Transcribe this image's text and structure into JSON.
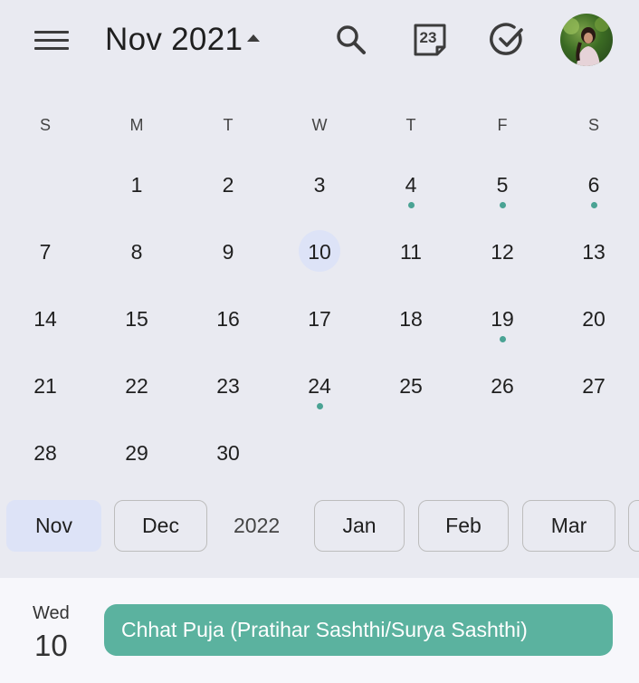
{
  "header": {
    "month_title": "Nov 2021",
    "today_icon_date": "23",
    "icons": [
      "menu-icon",
      "caret-up-icon",
      "search-icon",
      "calendar-today-icon",
      "tasks-check-icon",
      "avatar"
    ]
  },
  "weekdays": [
    "S",
    "M",
    "T",
    "W",
    "T",
    "F",
    "S"
  ],
  "calendar": {
    "selected_day": "10",
    "weeks": [
      [
        {
          "d": ""
        },
        {
          "d": "1"
        },
        {
          "d": "2"
        },
        {
          "d": "3"
        },
        {
          "d": "4",
          "event": true
        },
        {
          "d": "5",
          "event": true
        },
        {
          "d": "6",
          "event": true
        }
      ],
      [
        {
          "d": "7"
        },
        {
          "d": "8"
        },
        {
          "d": "9"
        },
        {
          "d": "10",
          "selected": true
        },
        {
          "d": "11"
        },
        {
          "d": "12"
        },
        {
          "d": "13"
        }
      ],
      [
        {
          "d": "14"
        },
        {
          "d": "15"
        },
        {
          "d": "16"
        },
        {
          "d": "17"
        },
        {
          "d": "18"
        },
        {
          "d": "19",
          "event": true
        },
        {
          "d": "20"
        }
      ],
      [
        {
          "d": "21"
        },
        {
          "d": "22"
        },
        {
          "d": "23"
        },
        {
          "d": "24",
          "event": true
        },
        {
          "d": "25"
        },
        {
          "d": "26"
        },
        {
          "d": "27"
        }
      ],
      [
        {
          "d": "28"
        },
        {
          "d": "29"
        },
        {
          "d": "30"
        },
        {
          "d": ""
        },
        {
          "d": ""
        },
        {
          "d": ""
        },
        {
          "d": ""
        }
      ]
    ]
  },
  "month_chips": {
    "current": "Nov",
    "next": "Dec",
    "year_label": "2022",
    "months": [
      "Jan",
      "Feb",
      "Mar"
    ]
  },
  "agenda": {
    "weekday": "Wed",
    "day": "10",
    "event_title": "Chhat Puja (Pratihar Sashthi/Surya Sashthi)"
  },
  "colors": {
    "background": "#e9eaf1",
    "selected_day_bg": "#dde3f7",
    "event_dot": "#4aa394",
    "event_chip": "#5bb29f",
    "agenda_bg": "#f7f7fb"
  }
}
